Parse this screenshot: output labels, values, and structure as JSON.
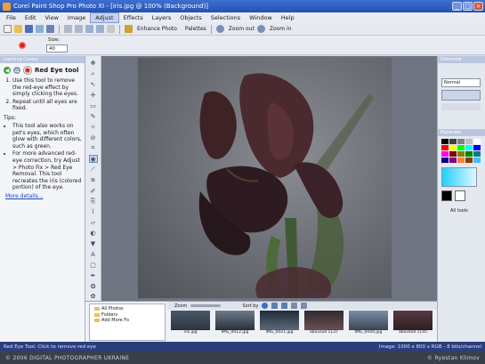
{
  "window": {
    "title": "Corel Paint Shop Pro Photo XI - [iris.jpg @ 100% (Background)]"
  },
  "menu": [
    "File",
    "Edit",
    "View",
    "Image",
    "Adjust",
    "Effects",
    "Layers",
    "Objects",
    "Selections",
    "Window",
    "Help"
  ],
  "toolbar": {
    "enhance_photo": "Enhance Photo",
    "palettes": "Palettes",
    "zoom_out": "Zoom out",
    "zoom_in": "Zoom in"
  },
  "tool_options": {
    "size_label": "Size:",
    "size_value": "40"
  },
  "learning_center": {
    "header": "Learning Center",
    "tool_name": "Red Eye tool",
    "steps": [
      "Use this tool to remove the red-eye effect by simply clicking the eyes.",
      "Repeat until all eyes are fixed."
    ],
    "tips_label": "Tips:",
    "tips": [
      "This tool also works on pet's eyes, which often glow with different colors, such as green.",
      "For more advanced red-eye correction, try Adjust > Photo Fix > Red Eye Removal. This tool recreates the iris (colored portion) of the eye."
    ],
    "more_link": "More details..."
  },
  "right_panel": {
    "overview_header": "Overview",
    "materials_header": "Materials",
    "blend_mode": "Normal",
    "all_tools_label": "All tools",
    "swatch_colors": [
      "#000000",
      "#404040",
      "#808080",
      "#c0c0c0",
      "#ffffff",
      "#ff0000",
      "#ffff00",
      "#00ff00",
      "#00ffff",
      "#0000ff",
      "#ff00ff",
      "#800000",
      "#808000",
      "#008000",
      "#008080",
      "#000080",
      "#800080",
      "#ff8040",
      "#804000",
      "#40c0ff"
    ]
  },
  "organizer": {
    "zoom_label": "Zoom",
    "sort_label": "Sort by",
    "folders": [
      "All Photos",
      "Folders",
      "Add More Fo"
    ],
    "thumbnails": [
      "iris.jpg",
      "IMG_0012.jpg",
      "IMG_0021.jpg",
      "aboveall 1137",
      "IMG_0044.jpg",
      "aboveall 1145"
    ]
  },
  "status": {
    "left": "Red Eye Tool: Click to remove red eye",
    "right": "Image: 1000 x 800 x RGB - 8 bits/channel"
  },
  "footer": {
    "left": "© 2006 DIGITAL PHOTOGRAPHER UKRAINE",
    "right": "© Ryestan Klimov"
  },
  "colors": {
    "accent": "#2552b0",
    "status_bg": "#2c3e7a"
  }
}
